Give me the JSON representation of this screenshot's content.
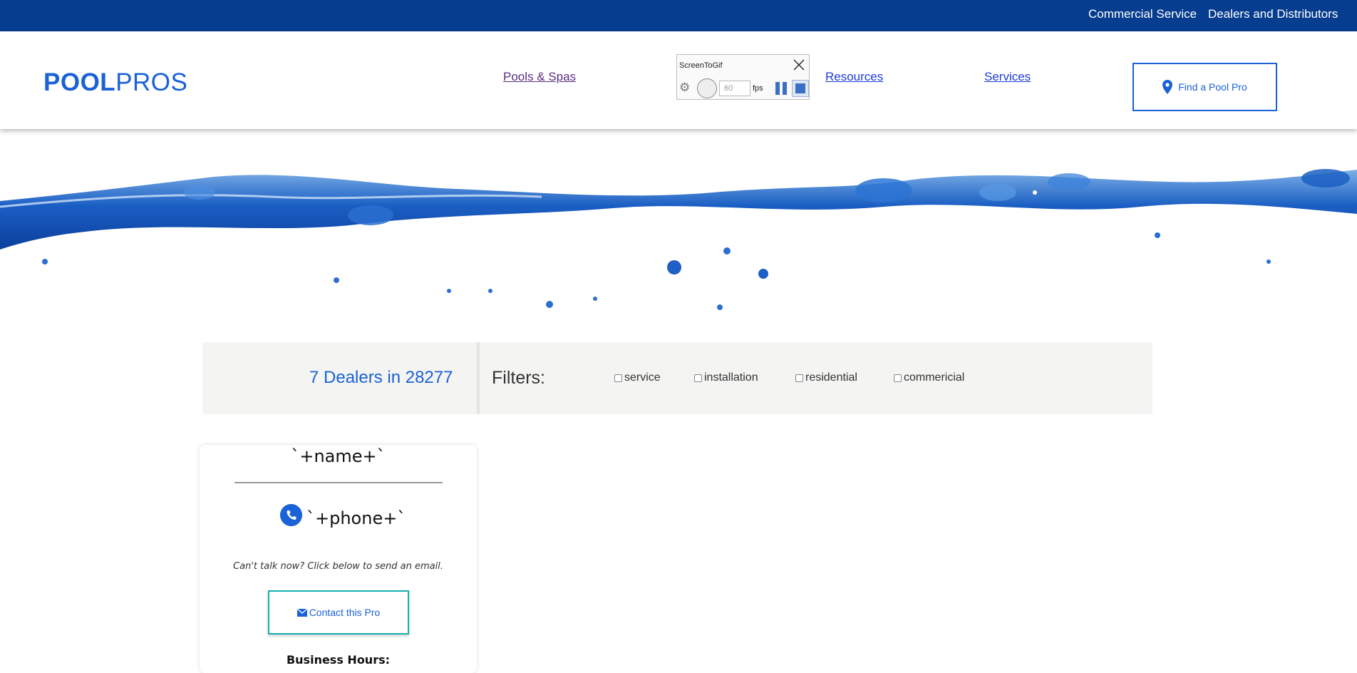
{
  "topbar": {
    "links": [
      "Commercial Service",
      "Dealers and Distributors"
    ]
  },
  "header": {
    "logo": {
      "part1": "POOL",
      "part2": "PROS"
    },
    "nav": {
      "pools": "Pools & Spas",
      "resources": "Resources",
      "services": "Services"
    },
    "find_button": "Find a Pool Pro"
  },
  "recorder": {
    "title": "ScreenToGif",
    "fps_value": "60",
    "fps_label": "fps"
  },
  "results": {
    "count_text": "7 Dealers in 28277",
    "filters_label": "Filters:",
    "filters": [
      {
        "label": "service",
        "checked": false
      },
      {
        "label": "installation",
        "checked": false
      },
      {
        "label": "residential",
        "checked": false
      },
      {
        "label": "commericial",
        "checked": false
      }
    ]
  },
  "dealer_card": {
    "name": "`+name+`",
    "phone": "`+phone+`",
    "email_prompt": "Can't talk now? Click below to send an email.",
    "contact_button": "Contact this Pro",
    "hours_label": "Business Hours:"
  },
  "colors": {
    "topbar": "#073d8f",
    "brand_blue": "#1a62d6",
    "contact_border": "#17b0b3"
  }
}
